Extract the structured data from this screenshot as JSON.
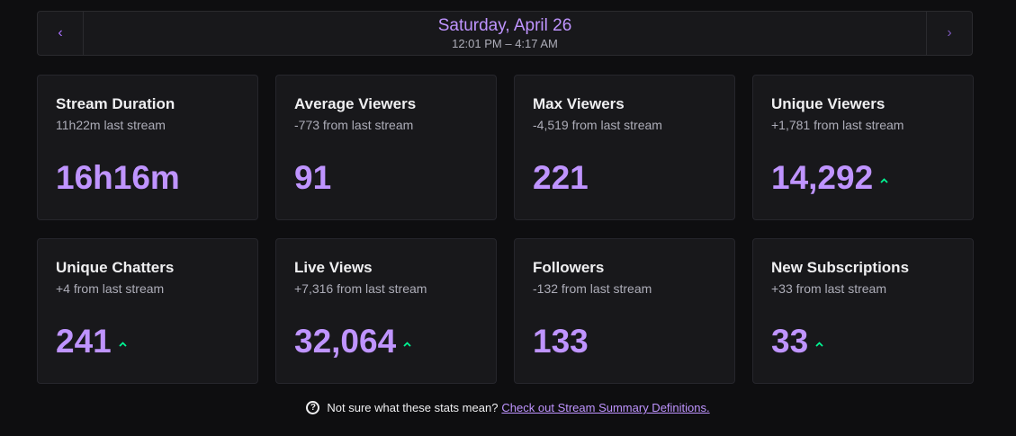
{
  "navigator": {
    "prev_icon": "chevron-left-icon",
    "next_icon": "chevron-right-icon",
    "prev_glyph": "‹",
    "next_glyph": "›",
    "date": "Saturday, April 26",
    "time_range": "12:01 PM – 4:17 AM"
  },
  "stats": [
    {
      "title": "Stream Duration",
      "comparison": "11h22m last stream",
      "value": "16h16m",
      "trend": "none"
    },
    {
      "title": "Average Viewers",
      "comparison": "-773 from last stream",
      "value": "91",
      "trend": "none"
    },
    {
      "title": "Max Viewers",
      "comparison": "-4,519 from last stream",
      "value": "221",
      "trend": "none"
    },
    {
      "title": "Unique Viewers",
      "comparison": "+1,781 from last stream",
      "value": "14,292",
      "trend": "up"
    },
    {
      "title": "Unique Chatters",
      "comparison": "+4 from last stream",
      "value": "241",
      "trend": "up"
    },
    {
      "title": "Live Views",
      "comparison": "+7,316 from last stream",
      "value": "32,064",
      "trend": "up"
    },
    {
      "title": "Followers",
      "comparison": "-132 from last stream",
      "value": "133",
      "trend": "none"
    },
    {
      "title": "New Subscriptions",
      "comparison": "+33 from last stream",
      "value": "33",
      "trend": "up"
    }
  ],
  "footer": {
    "icon": "question-circle-icon",
    "icon_glyph": "?",
    "text": "Not sure what these stats mean?",
    "link": "Check out Stream Summary Definitions."
  },
  "colors": {
    "accent": "#bf94ff",
    "trend_up": "#00f593",
    "background": "#0e0e10",
    "card": "#18181b"
  }
}
